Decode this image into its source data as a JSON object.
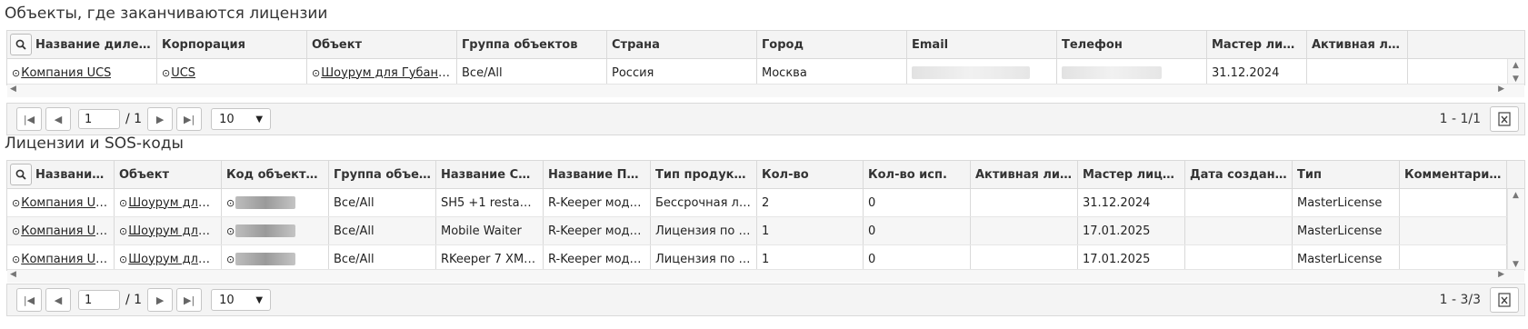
{
  "section1": {
    "title": "Объекты, где заканчиваются лицензии",
    "headers": [
      "Название дилера ...",
      "Корпорация",
      "Объект",
      "Группа объектов",
      "Страна",
      "Город",
      "Email",
      "Телефон",
      "Мастер лицен...",
      "Активная лиц..."
    ],
    "row": {
      "dealer": "Компания UCS",
      "corporation": "UCS",
      "object": "Шоурум для Губановой...",
      "group": "Все/All",
      "country": "Россия",
      "city": "Москва",
      "master": "31.12.2024",
      "active": ""
    },
    "pager": {
      "page": "1",
      "total": "/ 1",
      "page_size": "10",
      "range": "1 - 1/1"
    }
  },
  "section2": {
    "title": "Лицензии и SOS-коды",
    "headers": [
      "Название...",
      "Объект",
      "Код объекта ...",
      "Группа объе...",
      "Название Со...",
      "Название ПО...",
      "Тип продукт...",
      "Кол-во",
      "Кол-во исп.",
      "Активная лиц...",
      "Мастер лицен...",
      "Дата создани...",
      "Тип",
      "Комментарий..."
    ],
    "rows": [
      {
        "dealer": "Компания UCS",
        "object": "Шоурум для ...",
        "group": "Все/All",
        "soft": "SH5 +1 restaur...",
        "po": "R-Keeper модул...",
        "ptype": "Бессрочная ли...",
        "qty": "2",
        "used": "0",
        "active": "",
        "master": "31.12.2024",
        "created": "",
        "type": "MasterLicense",
        "comment": ""
      },
      {
        "dealer": "Компания UCS",
        "object": "Шоурум для ...",
        "group": "Все/All",
        "soft": "Mobile Waiter",
        "po": "R-Keeper модул...",
        "ptype": "Лицензия по п...",
        "qty": "1",
        "used": "0",
        "active": "",
        "master": "17.01.2025",
        "created": "",
        "type": "MasterLicense",
        "comment": ""
      },
      {
        "dealer": "Компания UCS",
        "object": "Шоурум для ...",
        "group": "Все/All",
        "soft": "RKeeper 7 XML ...",
        "po": "R-Keeper модул...",
        "ptype": "Лицензия по п...",
        "qty": "1",
        "used": "0",
        "active": "",
        "master": "17.01.2025",
        "created": "",
        "type": "MasterLicense",
        "comment": ""
      }
    ],
    "pager": {
      "page": "1",
      "total": "/ 1",
      "page_size": "10",
      "range": "1 - 3/3"
    }
  },
  "icons": {
    "search": "search-icon",
    "go": "navigate-circle-icon",
    "first": "first-page-icon",
    "prev": "prev-page-icon",
    "next": "next-page-icon",
    "last": "last-page-icon",
    "export": "excel-export-icon",
    "dropdown": "chevron-down-icon"
  },
  "colors": {
    "header_bg": "#f4f4f4",
    "border": "#d9d9d9",
    "alt_row": "#f6f6f6"
  }
}
